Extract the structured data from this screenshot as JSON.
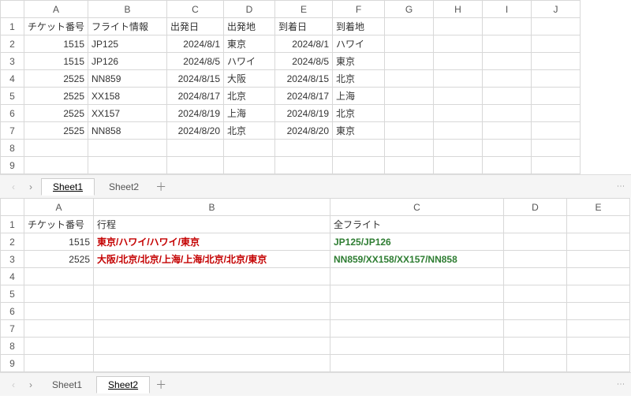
{
  "pane1": {
    "cols": [
      "A",
      "B",
      "C",
      "D",
      "E",
      "F",
      "G",
      "H",
      "I",
      "J"
    ],
    "headers": [
      "チケット番号",
      "フライト情報",
      "出発日",
      "出発地",
      "到着日",
      "到着地"
    ],
    "rows": [
      {
        "n": "1515",
        "f": "JP125",
        "dd": "2024/8/1",
        "dp": "東京",
        "ad": "2024/8/1",
        "ap": "ハワイ"
      },
      {
        "n": "1515",
        "f": "JP126",
        "dd": "2024/8/5",
        "dp": "ハワイ",
        "ad": "2024/8/5",
        "ap": "東京"
      },
      {
        "n": "2525",
        "f": "NN859",
        "dd": "2024/8/15",
        "dp": "大阪",
        "ad": "2024/8/15",
        "ap": "北京"
      },
      {
        "n": "2525",
        "f": "XX158",
        "dd": "2024/8/17",
        "dp": "北京",
        "ad": "2024/8/17",
        "ap": "上海"
      },
      {
        "n": "2525",
        "f": "XX157",
        "dd": "2024/8/19",
        "dp": "上海",
        "ad": "2024/8/19",
        "ap": "北京"
      },
      {
        "n": "2525",
        "f": "NN858",
        "dd": "2024/8/20",
        "dp": "北京",
        "ad": "2024/8/20",
        "ap": "東京"
      }
    ],
    "tabs": {
      "t1": "Sheet1",
      "t2": "Sheet2",
      "add": "＋",
      "menu": "⋮"
    }
  },
  "pane2": {
    "cols": [
      "A",
      "B",
      "C",
      "D",
      "E"
    ],
    "headers": {
      "a": "チケット番号",
      "b": "行程",
      "c": "全フライト"
    },
    "rows": [
      {
        "n": "1515",
        "route": "東京/ハワイ/ハワイ/東京",
        "flights": "JP125/JP126"
      },
      {
        "n": "2525",
        "route": "大阪/北京/北京/上海/上海/北京/北京/東京",
        "flights": "NN859/XX158/XX157/NN858"
      }
    ],
    "tabs": {
      "t1": "Sheet1",
      "t2": "Sheet2",
      "add": "＋",
      "menu": "⋮"
    }
  },
  "nav": {
    "prev": "‹",
    "next": "›"
  }
}
